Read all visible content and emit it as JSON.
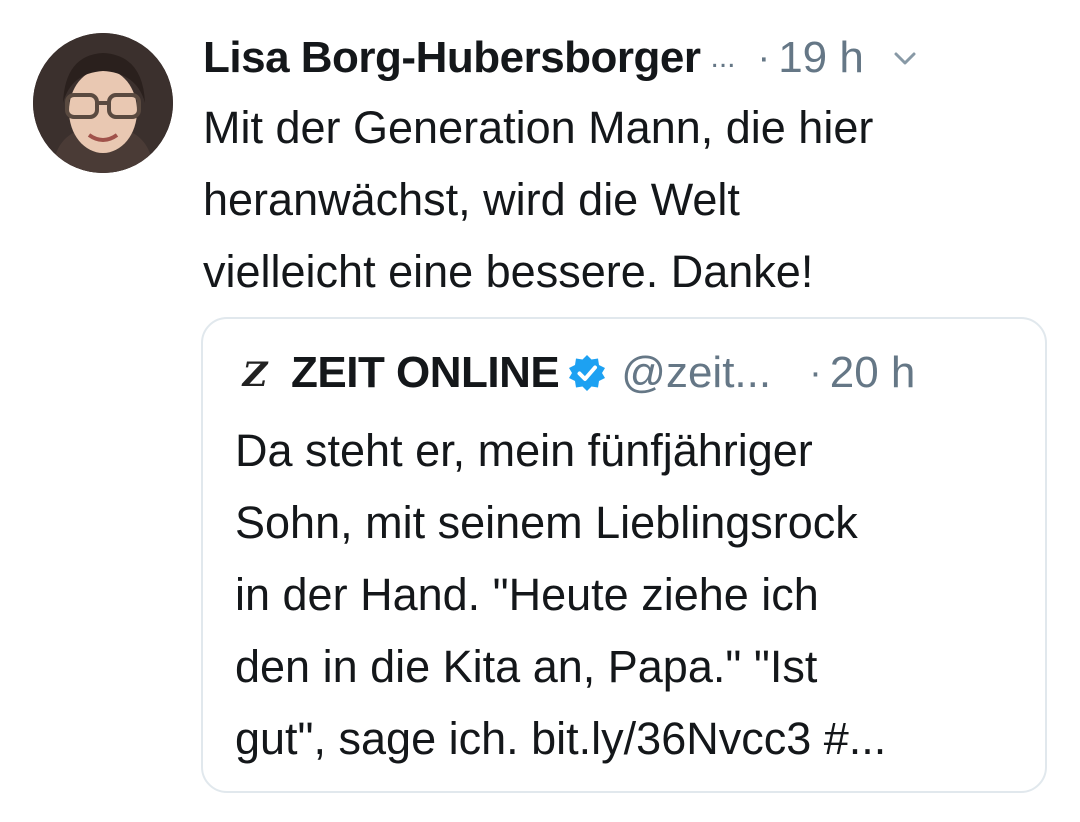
{
  "tweet": {
    "author_name": "Lisa Borg-Hubersborger",
    "name_ellipsis": "...",
    "separator": "·",
    "time": "19 h",
    "text_lines": [
      "Mit der Generation Mann, die hier",
      "heranwächst, wird die Welt",
      "vielleicht eine bessere. Danke!"
    ]
  },
  "quoted_tweet": {
    "logo_letter": "Z",
    "author_name": "ZEIT ONLINE",
    "handle": "@zeit...",
    "separator": "·",
    "time": "20 h",
    "text_lines": [
      "Da steht er, mein fünfjähriger",
      "Sohn, mit seinem Lieblingsrock",
      "in der Hand. \"Heute ziehe ich",
      "den in die Kita an, Papa.\" \"Ist",
      "gut\", sage ich. bit.ly/36Nvcc3 #..."
    ]
  },
  "icons": {
    "avatar": "avatar-photo",
    "chevron": "chevron-down-icon",
    "verified": "verified-badge-icon",
    "logo": "zeit-logo-icon"
  },
  "colors": {
    "text": "#14171a",
    "secondary": "#657786",
    "border": "#e1e8ed",
    "verified": "#1da1f2"
  }
}
